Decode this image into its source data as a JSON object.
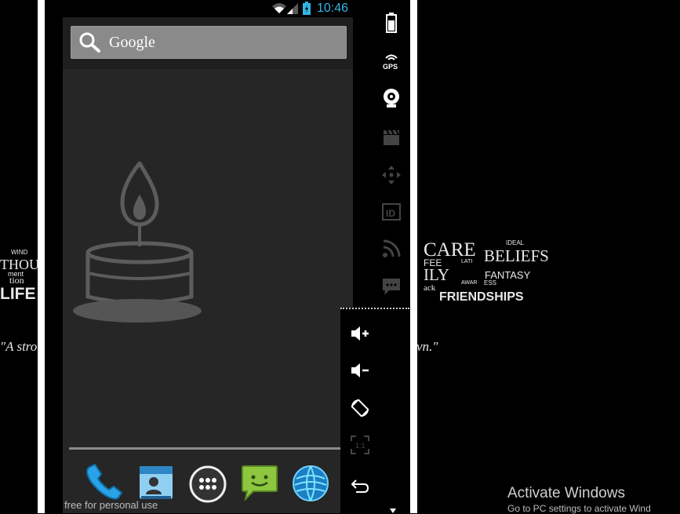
{
  "status_bar": {
    "time": "10:46"
  },
  "search": {
    "label": "Google"
  },
  "dock": {
    "items": [
      "phone-app",
      "contacts-app",
      "all-apps",
      "messaging-app",
      "browser-app"
    ]
  },
  "watermark": "free for personal use",
  "wallpaper": {
    "left_words": [
      "THOU",
      "LIFE",
      "tion",
      "ment",
      "WIND"
    ],
    "right_words": [
      "CARE",
      "BELIEFS",
      "IDEAL",
      "FANTASY",
      "FRIENDSHIPS",
      "ILY",
      "FEE",
      "LATI",
      "AWAR",
      "ESS",
      "ack"
    ],
    "quote_left": "\"A stro",
    "quote_right": "vn.\""
  },
  "sidebar_icons": [
    "battery-icon",
    "gps-icon",
    "camera-icon",
    "clapper-icon",
    "dpad-icon",
    "id-icon",
    "rss-icon",
    "sms-icon"
  ],
  "panel_buttons": [
    "volume-up-icon",
    "volume-down-icon",
    "rotate-icon",
    "scale-icon",
    "back-icon"
  ],
  "system": {
    "activate_title": "Activate Windows",
    "activate_sub": "Go to PC settings to activate Wind"
  }
}
